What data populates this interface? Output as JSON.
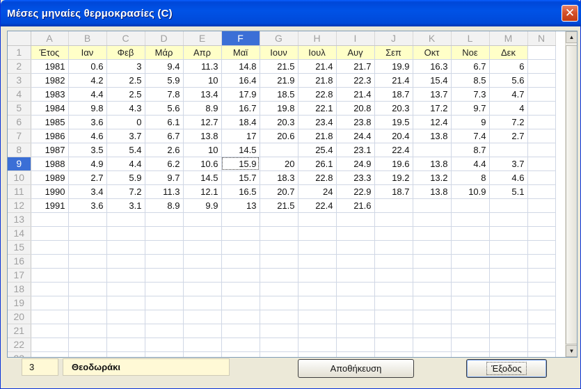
{
  "window": {
    "title": "Μέσες μηναίες θερμοκρασίες (C)",
    "close_glyph": "✕"
  },
  "grid": {
    "columns": [
      "A",
      "B",
      "C",
      "D",
      "E",
      "F",
      "G",
      "H",
      "I",
      "J",
      "K",
      "L",
      "M",
      "N"
    ],
    "selected_column": "F",
    "selected_row": 9,
    "row_count": 23,
    "header_row": [
      "Έτος",
      "Ιαν",
      "Φεβ",
      "Μάρ",
      "Απρ",
      "Μαϊ",
      "Ιουν",
      "Ιουλ",
      "Αυγ",
      "Σεπ",
      "Οκτ",
      "Νοε",
      "Δεκ"
    ],
    "rows": [
      [
        "1981",
        "0.6",
        "3",
        "9.4",
        "11.3",
        "14.8",
        "21.5",
        "21.4",
        "21.7",
        "19.9",
        "16.3",
        "6.7",
        "6"
      ],
      [
        "1982",
        "4.2",
        "2.5",
        "5.9",
        "10",
        "16.4",
        "21.9",
        "21.8",
        "22.3",
        "21.4",
        "15.4",
        "8.5",
        "5.6"
      ],
      [
        "1983",
        "4.4",
        "2.5",
        "7.8",
        "13.4",
        "17.9",
        "18.5",
        "22.8",
        "21.4",
        "18.7",
        "13.7",
        "7.3",
        "4.7"
      ],
      [
        "1984",
        "9.8",
        "4.3",
        "5.6",
        "8.9",
        "16.7",
        "19.8",
        "22.1",
        "20.8",
        "20.3",
        "17.2",
        "9.7",
        "4"
      ],
      [
        "1985",
        "3.6",
        "0",
        "6.1",
        "12.7",
        "18.4",
        "20.3",
        "23.4",
        "23.8",
        "19.5",
        "12.4",
        "9",
        "7.2"
      ],
      [
        "1986",
        "4.6",
        "3.7",
        "6.7",
        "13.8",
        "17",
        "20.6",
        "21.8",
        "24.4",
        "20.4",
        "13.8",
        "7.4",
        "2.7"
      ],
      [
        "1987",
        "3.5",
        "5.4",
        "2.6",
        "10",
        "14.5",
        "",
        "25.4",
        "23.1",
        "22.4",
        "",
        "8.7",
        ""
      ],
      [
        "1988",
        "4.9",
        "4.4",
        "6.2",
        "10.6",
        "15.9",
        "20",
        "26.1",
        "24.9",
        "19.6",
        "13.8",
        "4.4",
        "3.7"
      ],
      [
        "1989",
        "2.7",
        "5.9",
        "9.7",
        "14.5",
        "15.7",
        "18.3",
        "22.8",
        "23.3",
        "19.2",
        "13.2",
        "8",
        "4.6"
      ],
      [
        "1990",
        "3.4",
        "7.2",
        "11.3",
        "12.1",
        "16.5",
        "20.7",
        "24",
        "22.9",
        "18.7",
        "13.8",
        "10.9",
        "5.1"
      ],
      [
        "1991",
        "3.6",
        "3.1",
        "8.9",
        "9.9",
        "13",
        "21.5",
        "22.4",
        "21.6",
        "",
        "",
        "",
        ""
      ]
    ]
  },
  "scrollbar": {
    "up_glyph": "▲",
    "down_glyph": "▼"
  },
  "statusbar": {
    "cell_ref": "3",
    "cell_value": "Θεοδωράκι"
  },
  "buttons": {
    "save_label": "Αποθήκευση",
    "exit_label": "Έξοδος"
  },
  "colors": {
    "title_blue": "#0052e6",
    "header_yellow": "#ffffc8",
    "selection_blue": "#3b6fd6"
  }
}
